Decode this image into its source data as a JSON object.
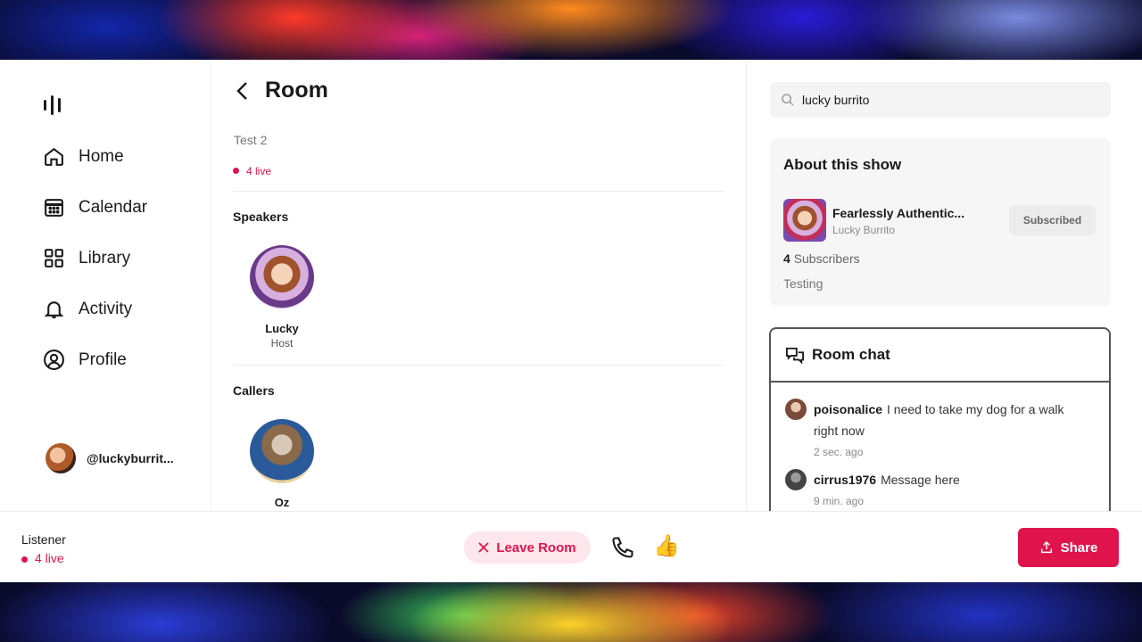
{
  "nav": {
    "items": [
      {
        "label": "Home",
        "icon": "home-icon"
      },
      {
        "label": "Calendar",
        "icon": "calendar-icon"
      },
      {
        "label": "Library",
        "icon": "library-icon"
      },
      {
        "label": "Activity",
        "icon": "bell-icon"
      },
      {
        "label": "Profile",
        "icon": "profile-icon"
      }
    ],
    "user_handle": "@luckyburrit..."
  },
  "room": {
    "title": "Room",
    "subtitle": "Test 2",
    "live_count": "4 live",
    "speakers_label": "Speakers",
    "speakers": [
      {
        "name": "Lucky",
        "role": "Host"
      }
    ],
    "callers_label": "Callers",
    "callers": [
      {
        "name": "Oz"
      }
    ]
  },
  "search": {
    "value": "lucky burrito"
  },
  "about": {
    "heading": "About this show",
    "show_name": "Fearlessly Authentic...",
    "show_author": "Lucky Burrito",
    "subscribe_label": "Subscribed",
    "subscriber_count": "4",
    "subscriber_label": "Subscribers",
    "description": "Testing"
  },
  "chat": {
    "heading": "Room chat",
    "messages": [
      {
        "user": "poisonalice",
        "text": "I need to take my dog for a walk right now",
        "ago": "2 sec. ago"
      },
      {
        "user": "cirrus1976",
        "text": "Message here",
        "ago": "9 min. ago"
      }
    ]
  },
  "bottom": {
    "role": "Listener",
    "live_count": "4 live",
    "leave_label": "Leave Room",
    "share_label": "Share"
  },
  "colors": {
    "accent": "#e0144c",
    "accent_soft": "#fde6ec"
  }
}
